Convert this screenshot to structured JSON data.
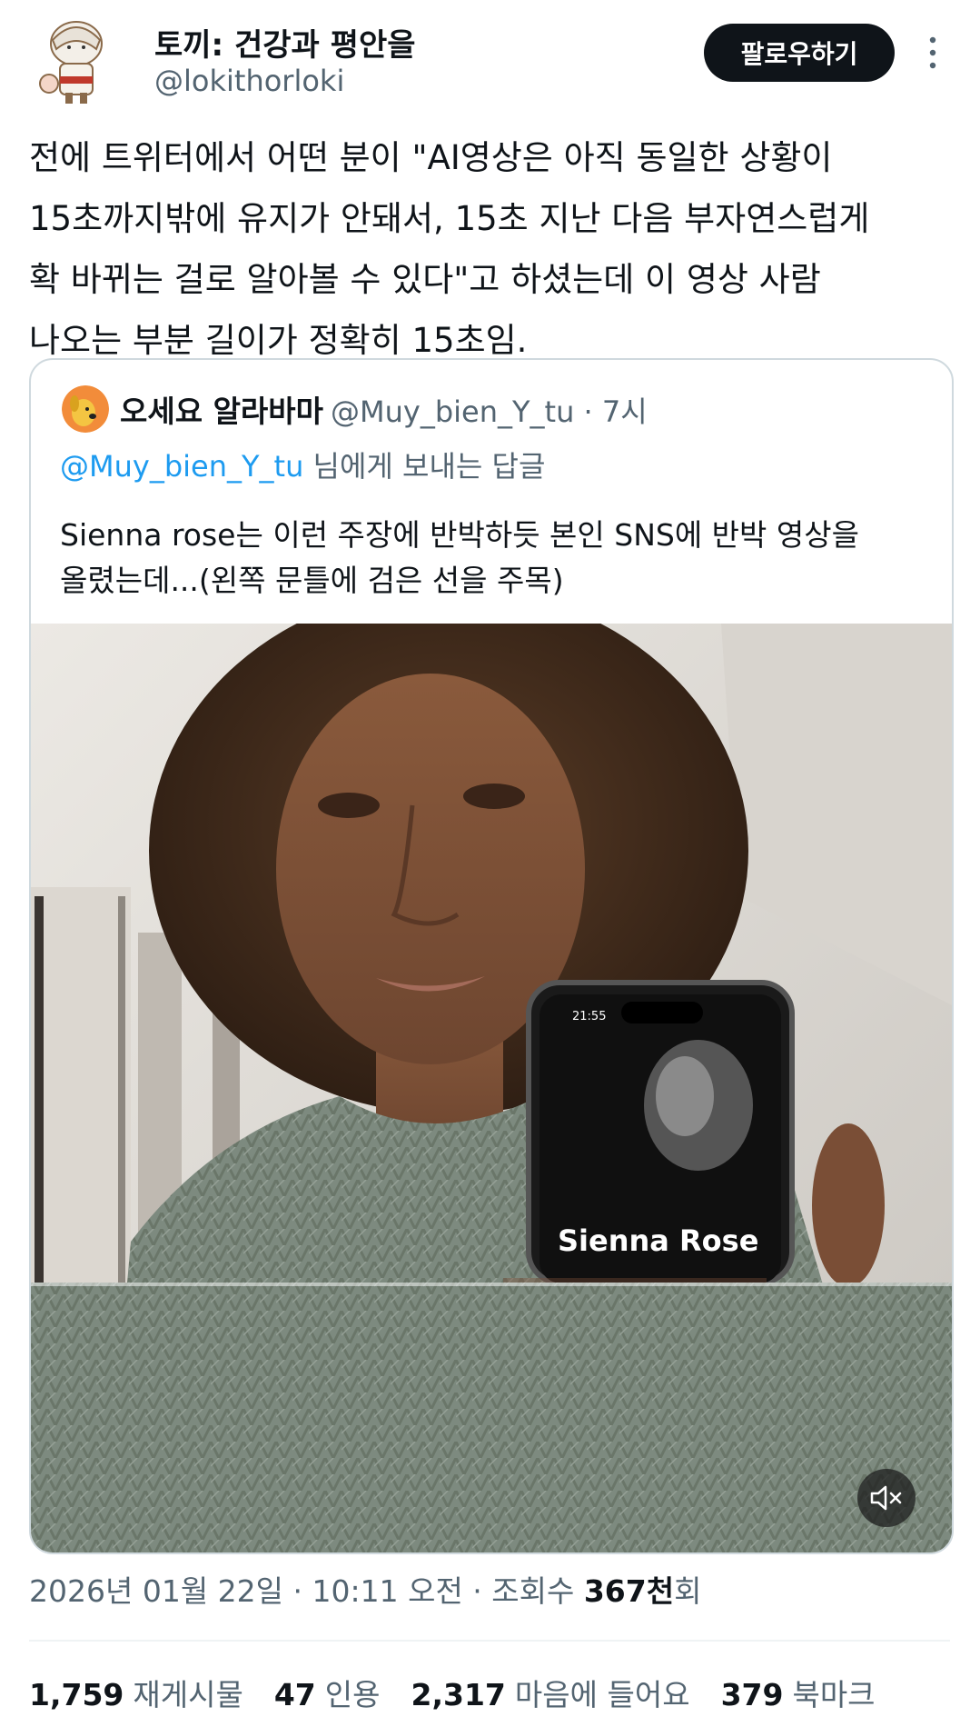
{
  "author": {
    "display_name": "토끼: 건강과 평안을",
    "handle": "@lokithorloki"
  },
  "follow_button": "팔로우하기",
  "tweet": {
    "text": "전에 트위터에서 어떤 분이 \"AI영상은 아직 동일한 상황이\n15초까지밖에 유지가 안돼서, 15초 지난 다음 부자연스럽게\n확 바뀌는 걸로 알아볼 수 있다\"고 하셨는데 이 영상 사람\n나오는 부분 길이가 정확히 15초임."
  },
  "quote": {
    "display_name": "오세요 알라바마",
    "handle_time": "@Muy_bien_Y_tu · 7시",
    "reply_mention": "@Muy_bien_Y_tu",
    "reply_suffix": " 님에게 보내는 답글",
    "text": "Sienna rose는 이런 주장에 반박하듯 본인 SNS에 반박 영상을\n올렸는데...(왼쪽 문틀에 검은 선을 주목)",
    "media": {
      "phone_time": "21:55",
      "phone_caption": "Sienna Rose"
    }
  },
  "meta": {
    "timestamp": "2026년 01월 22일 · 10:11 오전 · 조회수 ",
    "views_number": "367천",
    "views_suffix": "회"
  },
  "stats": [
    {
      "number": "1,759",
      "label": "재게시물"
    },
    {
      "number": "47",
      "label": "인용"
    },
    {
      "number": "2,317",
      "label": "마음에 들어요"
    },
    {
      "number": "379",
      "label": "북마크"
    }
  ],
  "colors": {
    "text_primary": "#0f1419",
    "text_secondary": "#536471",
    "link": "#1d9bf0",
    "border": "#cfd9de",
    "follow_bg": "#0f1419"
  },
  "icons": {
    "more": "more-vertical-icon",
    "mute": "volume-mute-icon"
  }
}
